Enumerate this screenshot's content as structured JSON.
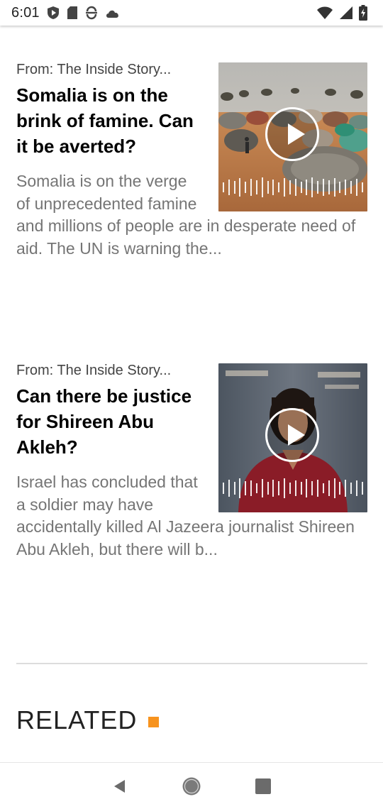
{
  "status_bar": {
    "time": "6:01",
    "icons": [
      "shield-play-icon",
      "sd-card-icon",
      "sync-icon",
      "cloud-icon"
    ],
    "right_icons": [
      "wifi-icon",
      "signal-icon",
      "battery-icon"
    ]
  },
  "stories": [
    {
      "source": "From: The Inside Story...",
      "headline": "Somalia is on the brink of famine. Can it be averted?",
      "summary": "Somalia is on the verge of unprecedented famine and millions of people are in desperate need of aid. The UN is warning the...",
      "thumbnail": "camp-photo"
    },
    {
      "source": "From: The Inside Story...",
      "headline": "Can there be justice for Shireen Abu Akleh?",
      "summary": "Israel has concluded that a soldier may have accidentally killed Al Jazeera journalist Shireen Abu Akleh, but there will b...",
      "thumbnail": "portrait-photo"
    }
  ],
  "related": {
    "title": "RELATED",
    "accent_color": "#f7931e"
  },
  "nav": [
    "back-icon",
    "home-icon",
    "recents-icon"
  ]
}
